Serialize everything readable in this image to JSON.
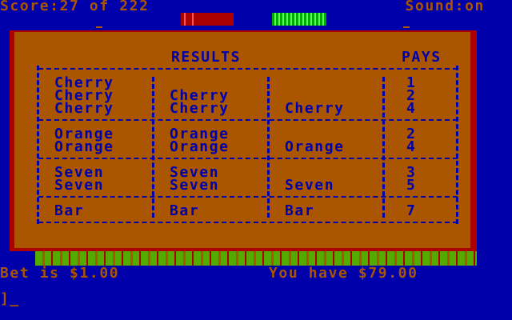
{
  "status": {
    "score": "Score:27 of 222",
    "sound": "Sound:on"
  },
  "results": {
    "header_results": "RESULTS",
    "header_pays": "PAYS",
    "rows": [
      {
        "c1": "Cherry",
        "c2": "",
        "c3": "",
        "pays": "1"
      },
      {
        "c1": "Cherry",
        "c2": "Cherry",
        "c3": "",
        "pays": "2"
      },
      {
        "c1": "Cherry",
        "c2": "Cherry",
        "c3": "Cherry",
        "pays": "4"
      },
      {
        "c1": "Orange",
        "c2": "Orange",
        "c3": "",
        "pays": "2"
      },
      {
        "c1": "Orange",
        "c2": "Orange",
        "c3": "Orange",
        "pays": "4"
      },
      {
        "c1": "Seven",
        "c2": "Seven",
        "c3": "",
        "pays": "3"
      },
      {
        "c1": "Seven",
        "c2": "Seven",
        "c3": "Seven",
        "pays": "5"
      },
      {
        "c1": "Bar",
        "c2": "Bar",
        "c3": "Bar",
        "pays": "7"
      }
    ]
  },
  "bottom": {
    "bet": "Bet is $1.00",
    "have": "You have $79.00",
    "prompt": "]_"
  },
  "colors": {
    "background": "#0000aa",
    "panel": "#aa5500",
    "border": "#aa0000",
    "text": "#aa5500"
  }
}
